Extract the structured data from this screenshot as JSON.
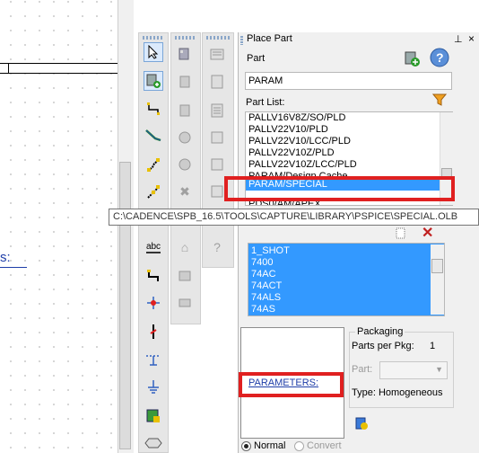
{
  "panel": {
    "title": "Place Part",
    "pin_icon": "pin-icon",
    "close_icon": "close-icon",
    "part_label": "Part",
    "part_value": "PARAM",
    "part_list_label": "Part List:",
    "part_list": [
      "PALLV16V8Z/SO/PLD",
      "PALLV22V10/PLD",
      "PALLV22V10/LCC/PLD",
      "PALLV22V10Z/PLD",
      "PALLV22V10Z/LCC/PLD",
      "PARAM/Design Cache",
      "PARAM/SPECIAL",
      "PDS0/AM/APEX"
    ],
    "selected_part": "PARAM/SPECIAL",
    "tooltip": "C:\\CADENCE\\SPB_16.5\\TOOLS\\CAPTURE\\LIBRARY\\PSPICE\\SPECIAL.OLB",
    "libraries": [
      "1_SHOT",
      "7400",
      "74AC",
      "74ACT",
      "74ALS",
      "74AS"
    ],
    "preview_text": "PARAMETERS:",
    "packaging": {
      "title": "Packaging",
      "parts_per_pkg_label": "Parts per Pkg:",
      "parts_per_pkg_value": "1",
      "part_label": "Part:",
      "type_label": "Type: Homogeneous"
    },
    "radio_normal": "Normal",
    "radio_convert": "Convert"
  },
  "canvas": {
    "label": "s:"
  },
  "toolbar": {
    "icons": [
      "select-icon",
      "place-part-icon",
      "wire-icon",
      "bus-icon",
      "junction-icon",
      "bus-entry-icon",
      "net-alias-icon",
      "net-group-icon",
      "power-icon",
      "ground-icon",
      "off-page-icon",
      "hier-block-icon",
      "text-icon",
      "line-icon",
      "polyline-icon"
    ],
    "abc_label": "abc"
  }
}
